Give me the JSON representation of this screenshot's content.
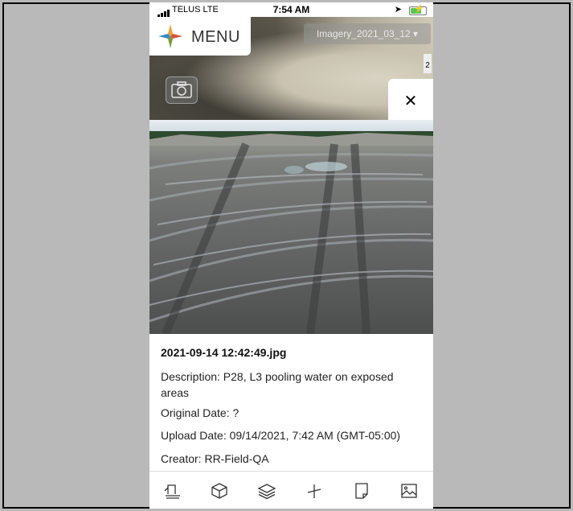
{
  "status_bar": {
    "carrier": "TELUS  LTE",
    "time": "7:54 AM"
  },
  "map": {
    "menu_label": "MENU",
    "imagery_selector": "Imagery_2021_03_12",
    "edge_badge": "2"
  },
  "photo_detail": {
    "filename": "2021-09-14 12:42:49.jpg",
    "description": "Description: P28, L3 pooling water on exposed areas",
    "original_date": "Original Date: ?",
    "upload_date": "Upload Date: 09/14/2021, 7:42 AM (GMT-05:00)",
    "creator": "Creator: RR-Field-QA"
  },
  "toolbar": {
    "items": [
      "survey-icon",
      "box-icon",
      "layers-icon",
      "measure-icon",
      "document-icon",
      "image-icon"
    ]
  },
  "colors": {
    "background": "#b9b9b9",
    "panel": "#ffffff",
    "battery": "#5ac552"
  }
}
